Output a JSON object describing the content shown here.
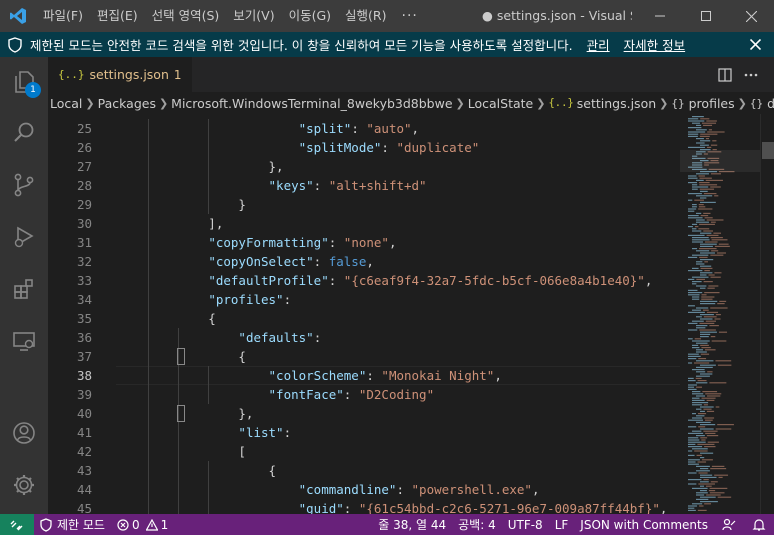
{
  "titlebar": {
    "menus": [
      "파일(F)",
      "편집(E)",
      "선택 영역(S)",
      "보기(V)",
      "이동(G)",
      "실행(R)"
    ],
    "more": "···",
    "title": "● settings.json - Visual Studio Code"
  },
  "banner": {
    "text": "제한된 모드는 안전한 코드 검색을 위한 것입니다. 이 창을 신뢰하여 모든 기능을 사용하도록 설정합니다.",
    "manage_link": "관리",
    "details_link": "자세한 정보"
  },
  "activity": {
    "explorer_badge": "1"
  },
  "tab": {
    "icon": "{..}",
    "label": "settings.json",
    "problems_count": "1"
  },
  "breadcrumb": {
    "items": [
      "Local",
      "Packages",
      "Microsoft.WindowsTerminal_8wekyb3d8bbwe",
      "LocalState",
      "settings.json",
      "profiles",
      "defaults"
    ],
    "json_icon": "{..}",
    "object_icon": "{}"
  },
  "editor": {
    "first_line": 25,
    "active_line": 38,
    "lines": [
      [
        [
          "p",
          "                        "
        ],
        [
          "k",
          "\"split\""
        ],
        [
          "p",
          ": "
        ],
        [
          "s",
          "\"auto\""
        ],
        [
          "p",
          ","
        ]
      ],
      [
        [
          "p",
          "                        "
        ],
        [
          "k",
          "\"splitMode\""
        ],
        [
          "p",
          ": "
        ],
        [
          "s",
          "\"duplicate\""
        ]
      ],
      [
        [
          "p",
          "                    },"
        ]
      ],
      [
        [
          "p",
          "                    "
        ],
        [
          "k",
          "\"keys\""
        ],
        [
          "p",
          ": "
        ],
        [
          "s",
          "\"alt+shift+d\""
        ]
      ],
      [
        [
          "p",
          "                }"
        ]
      ],
      [
        [
          "p",
          "            ],"
        ]
      ],
      [
        [
          "p",
          "            "
        ],
        [
          "k",
          "\"copyFormatting\""
        ],
        [
          "p",
          ": "
        ],
        [
          "s",
          "\"none\""
        ],
        [
          "p",
          ","
        ]
      ],
      [
        [
          "p",
          "            "
        ],
        [
          "k",
          "\"copyOnSelect\""
        ],
        [
          "p",
          ": "
        ],
        [
          "kw",
          "false"
        ],
        [
          "p",
          ","
        ]
      ],
      [
        [
          "p",
          "            "
        ],
        [
          "k",
          "\"defaultProfile\""
        ],
        [
          "p",
          ": "
        ],
        [
          "s",
          "\"{c6eaf9f4-32a7-5fdc-b5cf-066e8a4b1e40}\""
        ],
        [
          "p",
          ","
        ]
      ],
      [
        [
          "p",
          "            "
        ],
        [
          "k",
          "\"profiles\""
        ],
        [
          "p",
          ":"
        ]
      ],
      [
        [
          "p",
          "            {"
        ]
      ],
      [
        [
          "p",
          "                "
        ],
        [
          "k",
          "\"defaults\""
        ],
        [
          "p",
          ":"
        ]
      ],
      [
        [
          "p",
          "                {"
        ]
      ],
      [
        [
          "p",
          "                    "
        ],
        [
          "k",
          "\"colorScheme\""
        ],
        [
          "p",
          ": "
        ],
        [
          "s",
          "\"Monokai Night\""
        ],
        [
          "p",
          ","
        ]
      ],
      [
        [
          "p",
          "                    "
        ],
        [
          "k",
          "\"fontFace\""
        ],
        [
          "p",
          ": "
        ],
        [
          "s",
          "\"D2Coding\""
        ]
      ],
      [
        [
          "p",
          "                },"
        ]
      ],
      [
        [
          "p",
          "                "
        ],
        [
          "k",
          "\"list\""
        ],
        [
          "p",
          ":"
        ]
      ],
      [
        [
          "p",
          "                ["
        ]
      ],
      [
        [
          "p",
          "                    {"
        ]
      ],
      [
        [
          "p",
          "                        "
        ],
        [
          "k",
          "\"commandline\""
        ],
        [
          "p",
          ": "
        ],
        [
          "s",
          "\"powershell.exe\""
        ],
        [
          "p",
          ","
        ]
      ],
      [
        [
          "p",
          "                        "
        ],
        [
          "k",
          "\"guid\""
        ],
        [
          "p",
          ": "
        ],
        [
          "s",
          "\"{61c54bbd-c2c6-5271-96e7-009a87ff44bf}\""
        ],
        [
          "p",
          ","
        ]
      ]
    ]
  },
  "status": {
    "restricted": "제한 모드",
    "errors": "0",
    "warnings": "1",
    "position": "줄 38, 열 44",
    "spaces": "공백: 4",
    "encoding": "UTF-8",
    "eol": "LF",
    "language": "JSON with Comments"
  },
  "colors": {
    "titlebar": "#3c3c3c",
    "banner": "#063b49",
    "activitybar": "#333333",
    "editor": "#1e1e1e",
    "statusbar": "#68217a",
    "remote": "#16825d",
    "string": "#ce9178",
    "key": "#9cdcfe",
    "keyword": "#569cd6"
  }
}
